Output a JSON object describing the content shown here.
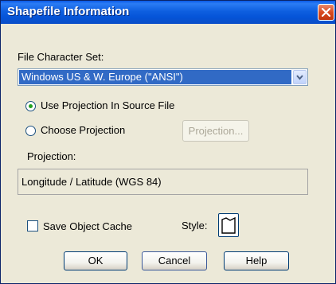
{
  "window": {
    "title": "Shapefile Information",
    "close_icon": "close-icon"
  },
  "charset": {
    "label": "File Character Set:",
    "selected": "Windows US & W. Europe (\"ANSI\")",
    "arrow_icon": "chevron-down-icon"
  },
  "projection_mode": {
    "options": [
      {
        "label": "Use Projection In Source File",
        "selected": true
      },
      {
        "label": "Choose Projection",
        "selected": false
      }
    ],
    "projection_button": "Projection..."
  },
  "projection": {
    "label": "Projection:",
    "value": "Longitude / Latitude (WGS 84)"
  },
  "cache": {
    "label": "Save Object Cache",
    "checked": false
  },
  "style": {
    "label": "Style:",
    "icon": "polygon-style-icon"
  },
  "buttons": {
    "ok": "OK",
    "cancel": "Cancel",
    "help": "Help"
  },
  "colors": {
    "titlebar": "#0554d8",
    "selection": "#316ac5",
    "dialog_bg": "#ece9d8",
    "close_button": "#d84a20"
  }
}
